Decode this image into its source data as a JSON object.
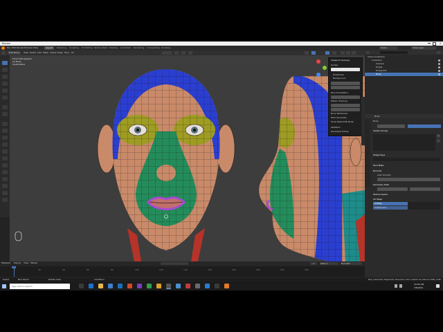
{
  "app": {
    "window_title": "Blender",
    "menus": [
      "File",
      "Edit",
      "Render",
      "Window",
      "Help"
    ],
    "workspace_tabs": [
      "Layout",
      "Modeling",
      "Sculpting",
      "UV Editing",
      "Texture Paint",
      "Shading",
      "Animation",
      "Rendering",
      "Compositing",
      "Scripting"
    ],
    "active_tab": "Layout",
    "scene_name": "Scene",
    "view_layer": "View Layer"
  },
  "viewport": {
    "view_name": "Front Orthographic",
    "object_name": "(1) Body",
    "units": "Centimeters",
    "header_items": [
      "Edit Mode",
      "View",
      "Select",
      "Add",
      "Mesh",
      "Vertex",
      "Edge",
      "Face",
      "UV"
    ],
    "overlay_popover": {
      "title": "Viewport Overlays",
      "guides_label": "Guides",
      "items": [
        "Wireframe",
        "Background",
        "Face Orientation",
        "Motion Tracking",
        "Bone Wireframe",
        "Fade Geometry",
        "Show Mesh Edit Mode"
      ],
      "checkbox_items": [
        "Show Mesh Edit Mode",
        "Show Vertex",
        "Show Edit Wireframe",
        "Show Face Orientation",
        "Statistics",
        "Developer Extras"
      ]
    }
  },
  "outliner": {
    "title": "Scene Collection",
    "items": [
      "Collection",
      "Camera",
      "Empty",
      "Empty.001",
      "Body"
    ],
    "selected": "Body"
  },
  "properties": {
    "object_name": "Body",
    "mesh_name": "Body",
    "vertex_groups_title": "Vertex Groups",
    "shape_keys_title": "Shape Keys",
    "face_maps_title": "Face Maps",
    "normals_title": "Normals",
    "auto_smooth_label": "Auto Smooth",
    "geometry_data_title": "Geometry Data",
    "texture_space_title": "Texture Space",
    "uv_maps_title": "UV Maps",
    "uv_maps": [
      "UVMap",
      "UVMap.001"
    ],
    "fields": [
      "Vertex Groups",
      "Weight",
      "Selection",
      "Normals"
    ],
    "add_label": "+",
    "remove_label": "-"
  },
  "timeline": {
    "menu_items": [
      "Playback",
      "Keying",
      "View",
      "Marker"
    ],
    "current_frame": "1",
    "start_label": "Start",
    "start_value": "1",
    "end_label": "End",
    "end_value": "250",
    "ticks": [
      "0",
      "20",
      "40",
      "60",
      "80",
      "100",
      "120",
      "140",
      "160",
      "180",
      "200",
      "220",
      "240"
    ]
  },
  "statusbar": {
    "left_items": [
      "Select",
      "Box Select",
      "Rotate View",
      "Call Menu"
    ],
    "right_text": "Body | Verts:0/10 | Edges:0/20 | Faces:0/10 | Tris:0 | Objects:1/4 | Mem:27.0 MiB | v2.80.75"
  },
  "taskbar": {
    "search_placeholder": "Type here to search",
    "clock_time": "10:04 AM",
    "clock_date": "7/8/2019"
  },
  "colors": {
    "skin": "#c98a6a",
    "wire": "#1a1410",
    "blue_region": "#2a3ed0",
    "yellow_region": "#9e9c22",
    "green_region": "#238c5a",
    "purple_region": "#a84ad2",
    "red_region": "#b53328",
    "accent": "#4772b3"
  }
}
